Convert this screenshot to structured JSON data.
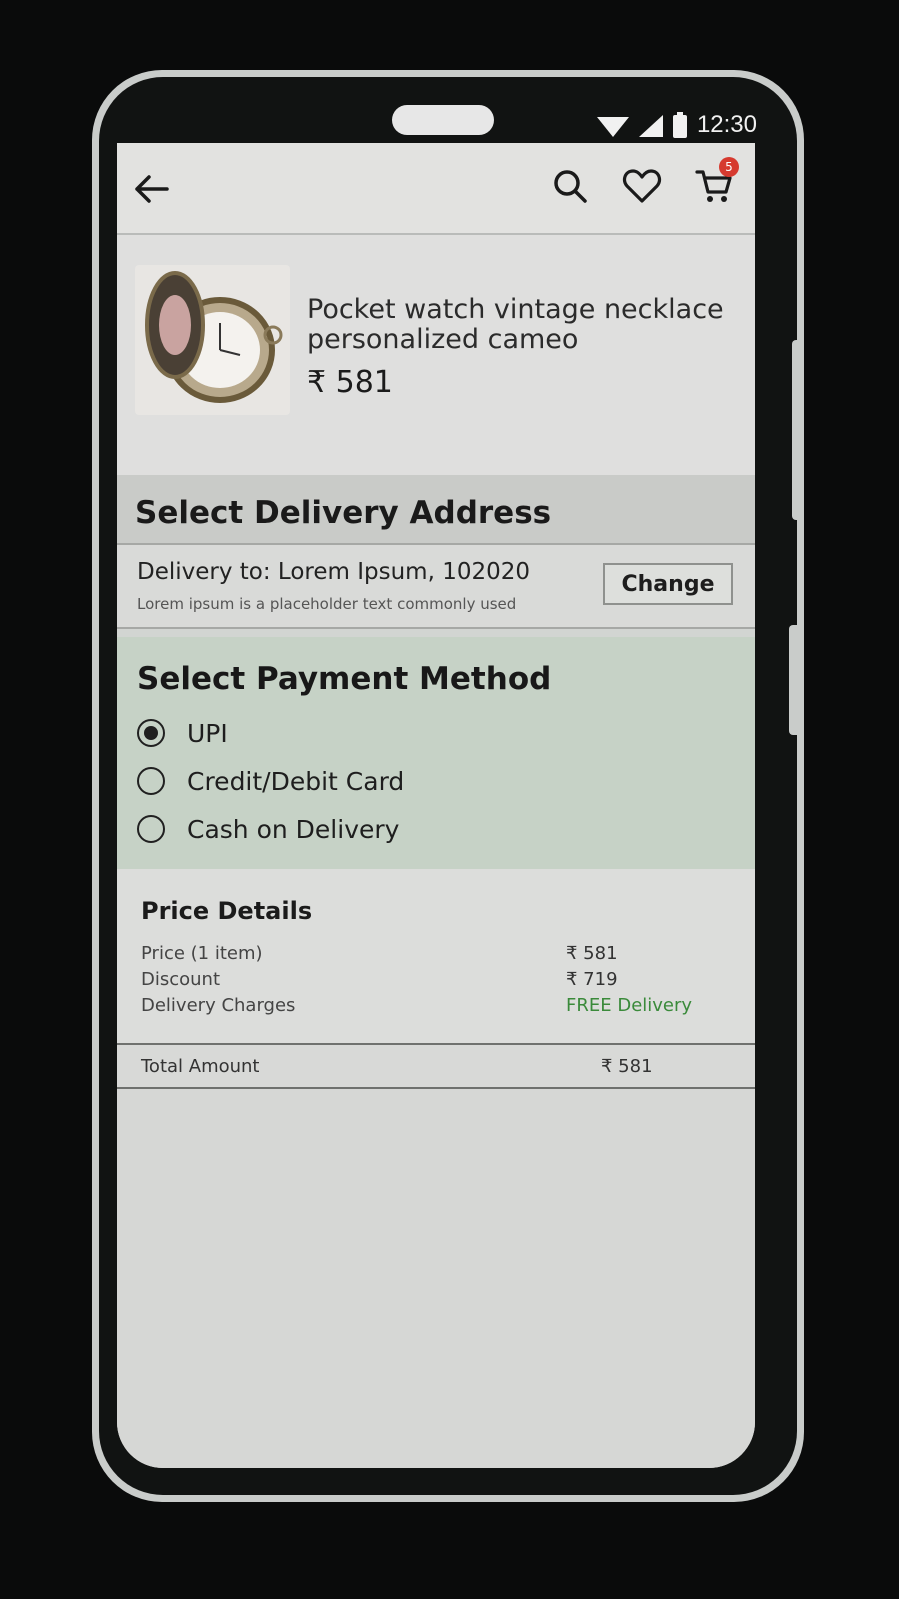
{
  "status_bar": {
    "time": "12:30"
  },
  "app_bar": {
    "cart_count": "5"
  },
  "product": {
    "title": "Pocket watch vintage necklace personalized cameo",
    "price": "₹ 581"
  },
  "delivery": {
    "heading": "Select Delivery Address",
    "to": "Delivery to: Lorem Ipsum, 102020",
    "sub": "Lorem ipsum is a placeholder text commonly used",
    "change_label": "Change"
  },
  "payment": {
    "heading": "Select Payment Method",
    "options": [
      {
        "label": "UPI",
        "selected": true
      },
      {
        "label": "Credit/Debit Card",
        "selected": false
      },
      {
        "label": "Cash on Delivery",
        "selected": false
      }
    ]
  },
  "price_details": {
    "heading": "Price Details",
    "rows": [
      {
        "label": "Price (1 item)",
        "value": "₹ 581"
      },
      {
        "label": "Discount",
        "value": "₹ 719"
      },
      {
        "label": "Delivery Charges",
        "value": "FREE Delivery"
      }
    ],
    "total_label": "Total Amount",
    "total_value": "₹ 581"
  },
  "colors": {
    "free_delivery": "#3a8a3a",
    "cart_badge": "#d63a2f"
  }
}
